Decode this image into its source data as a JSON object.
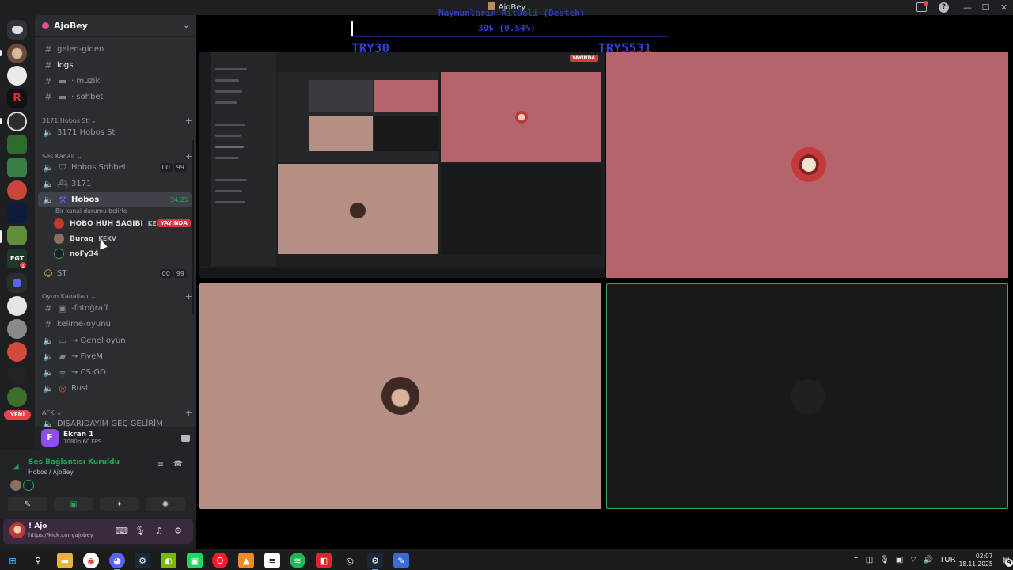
{
  "window": {
    "title": "AjoBey"
  },
  "guild": {
    "name": "AjoBey"
  },
  "channels": {
    "gelen_giden": "gelen-giden",
    "logs": "logs",
    "muzik": "· muzik",
    "sohbet": "· sohbet",
    "cat_hobos_st": "3171 Hobos St",
    "hobos_st_voice": "3171 Hobos St",
    "cat_ses": "Ses Kanalı",
    "hobos_sohbet": "Hobos Sohbet",
    "hobos_sohbet_c1": "00",
    "hobos_sohbet_c2": "99",
    "v3171": "3171",
    "hobos": "Hobos",
    "hobos_timer": "34:25",
    "hobos_status": "Bir kanal durumu belirle",
    "st": "ST",
    "st_c1": "00",
    "st_c2": "99",
    "cat_oyun": "Oyun Kanalları",
    "fotograff": "-fotoğraff",
    "kelime": "kelime-oyunu",
    "genel_oyun": "→ Genel oyun",
    "fivem": "→ FiveM",
    "csgo": "→ CS:GO",
    "rust": "Rust",
    "cat_afk": "AFK",
    "disaridayim": "DIŞARIDAYIM GEÇ GELİRİM"
  },
  "voice_users": [
    {
      "name": "HOBO HUH SAGIBI",
      "tag": "KEKV",
      "live": "YAYINDA"
    },
    {
      "name": "Buraq",
      "tag": "KEKV"
    },
    {
      "name": "noFy34"
    }
  ],
  "stream_panel": {
    "name": "Ekran 1",
    "quality": "1080p 60 FPS"
  },
  "voice_panel": {
    "status": "Ses Bağlantısı Kuruldu",
    "channel": "Hobos / AjoBey"
  },
  "user_panel": {
    "name": "! Ajo",
    "link": "https://kick.com/ajobey"
  },
  "rail": {
    "new_label": "YENİ"
  },
  "overlay": {
    "title": "Maymunların Ritüeli (Destek)",
    "amount": "30₺ (0.54%)",
    "left_value": "TRY30",
    "right_value": "TRY5531"
  },
  "stream": {
    "live_label": "YAYINDA"
  },
  "taskbar": {
    "lang": "TUR",
    "time": "02:07",
    "date": "18.11.2025",
    "notif": "9"
  },
  "colors": {
    "accent_green": "#23a55a",
    "live_red": "#da373c",
    "overlay_blue": "#2f3fd6"
  }
}
